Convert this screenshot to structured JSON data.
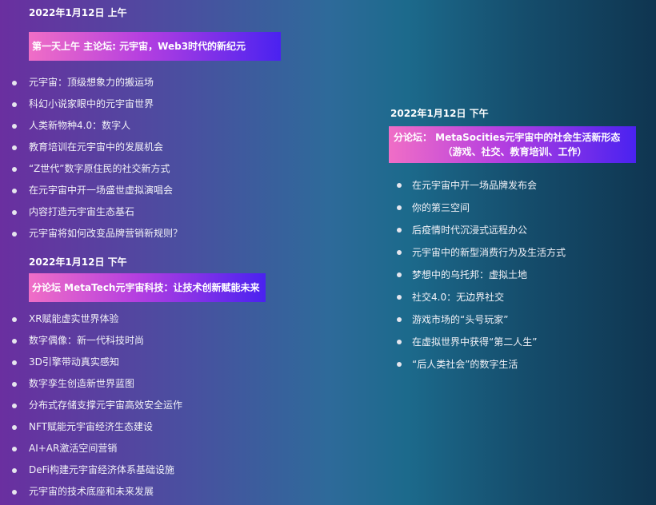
{
  "morning": {
    "date": "2022年1月12日 上午",
    "banner": "第一天上午  主论坛: 元宇宙，Web3时代的新纪元",
    "items": [
      "元宇宙：顶级想象力的搬运场",
      "科幻小说家眼中的元宇宙世界",
      "人类新物种4.0：数字人",
      "教育培训在元宇宙中的发展机会",
      "“Z世代”数字原住民的社交新方式",
      "在元宇宙中开一场盛世虚拟演唱会",
      "内容打造元宇宙生态基石",
      "元宇宙将如何改变品牌营销新规则？"
    ]
  },
  "afternoon_tech": {
    "date": "2022年1月12日  下午",
    "banner": "分论坛  MetaTech元宇宙科技：让技术创新赋能未来",
    "items": [
      "XR赋能虚实世界体验",
      "数字偶像：新一代科技时尚",
      "3D引擎带动真实感知",
      "数字孪生创造新世界蓝图",
      "分布式存储支撑元宇宙高效安全运作",
      "NFT赋能元宇宙经济生态建设",
      "AI+AR激活空间营销",
      "DeFi构建元宇宙经济体系基础设施",
      "元宇宙的技术底座和未来发展"
    ]
  },
  "afternoon_social": {
    "date": "2022年1月12日   下午",
    "banner_line1": "分论坛：  MetaSocities元宇宙中的社会生活新形态",
    "banner_line2": "（游戏、社交、教育培训、工作）",
    "items": [
      "在元宇宙中开一场品牌发布会",
      "你的第三空间",
      "后疫情时代沉浸式远程办公",
      "元宇宙中的新型消费行为及生活方式",
      "梦想中的乌托邦：虚拟土地",
      "社交4.0：无边界社交",
      "游戏市场的“头号玩家”",
      "在虚拟世界中获得“第二人生”",
      "“后人类社会”的数字生活"
    ]
  }
}
